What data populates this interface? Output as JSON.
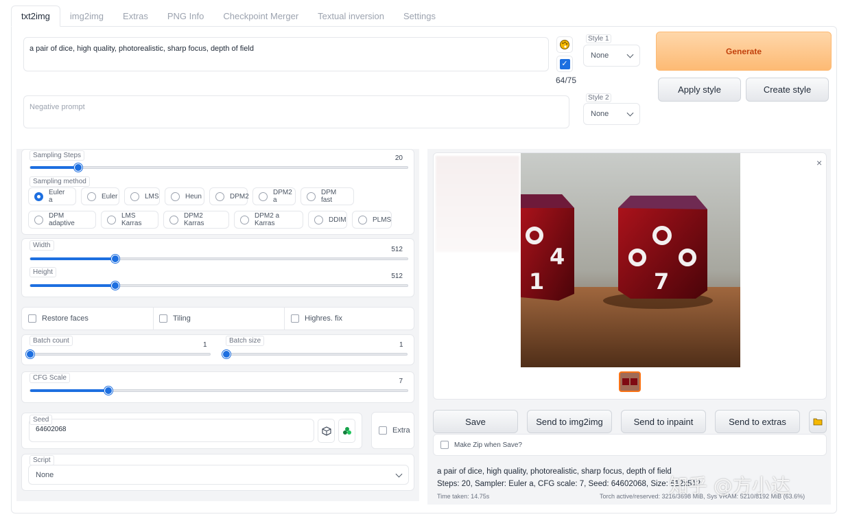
{
  "tabs": [
    {
      "label": "txt2img",
      "active": true
    },
    {
      "label": "img2img"
    },
    {
      "label": "Extras"
    },
    {
      "label": "PNG Info"
    },
    {
      "label": "Checkpoint Merger"
    },
    {
      "label": "Textual inversion"
    },
    {
      "label": "Settings"
    }
  ],
  "prompt": {
    "value": "a pair of dice, high quality, photorealistic, sharp focus, depth of field",
    "negative_placeholder": "Negative prompt",
    "token_count": "64/75"
  },
  "styles": {
    "style1_label": "Style 1",
    "style1_value": "None",
    "style2_label": "Style 2",
    "style2_value": "None"
  },
  "actions": {
    "generate": "Generate",
    "apply_style": "Apply style",
    "create_style": "Create style"
  },
  "sampling_steps": {
    "label": "Sampling Steps",
    "value": 20,
    "min": 1,
    "max": 150
  },
  "sampling_method": {
    "label": "Sampling method",
    "selected": "Euler a",
    "options": [
      "Euler a",
      "Euler",
      "LMS",
      "Heun",
      "DPM2",
      "DPM2 a",
      "DPM fast",
      "DPM adaptive",
      "LMS Karras",
      "DPM2 Karras",
      "DPM2 a Karras",
      "DDIM",
      "PLMS"
    ]
  },
  "width": {
    "label": "Width",
    "value": 512,
    "min": 64,
    "max": 2048
  },
  "height": {
    "label": "Height",
    "value": 512,
    "min": 64,
    "max": 2048
  },
  "checkboxes": {
    "restore_faces": "Restore faces",
    "tiling": "Tiling",
    "highres_fix": "Highres. fix"
  },
  "batch_count": {
    "label": "Batch count",
    "value": 1,
    "min": 1,
    "max": 100
  },
  "batch_size": {
    "label": "Batch size",
    "value": 1,
    "min": 1,
    "max": 8
  },
  "cfg_scale": {
    "label": "CFG Scale",
    "value": 7,
    "min": 1,
    "max": 30
  },
  "seed": {
    "label": "Seed",
    "value": "64602068",
    "extra": "Extra"
  },
  "script": {
    "label": "Script",
    "value": "None"
  },
  "output_buttons": {
    "save": "Save",
    "send_img2img": "Send to img2img",
    "send_inpaint": "Send to inpaint",
    "send_extras": "Send to extras"
  },
  "make_zip": "Make Zip when Save?",
  "generation_info": {
    "prompt_line": "a pair of dice, high quality, photorealistic, sharp focus, depth of field",
    "params_line": "Steps: 20, Sampler: Euler a, CFG scale: 7, Seed: 64602068, Size: 512x512",
    "time_taken": "Time taken: 14.75s",
    "vram": "Torch active/reserved: 3216/3698 MiB, Sys VRAM: 5210/8192 MiB (63.6%)"
  },
  "watermark": "知乎 @方小达",
  "colors": {
    "accent": "#1d6fe0",
    "generate_bg": "#fdba74",
    "generate_text": "#c2410c"
  }
}
